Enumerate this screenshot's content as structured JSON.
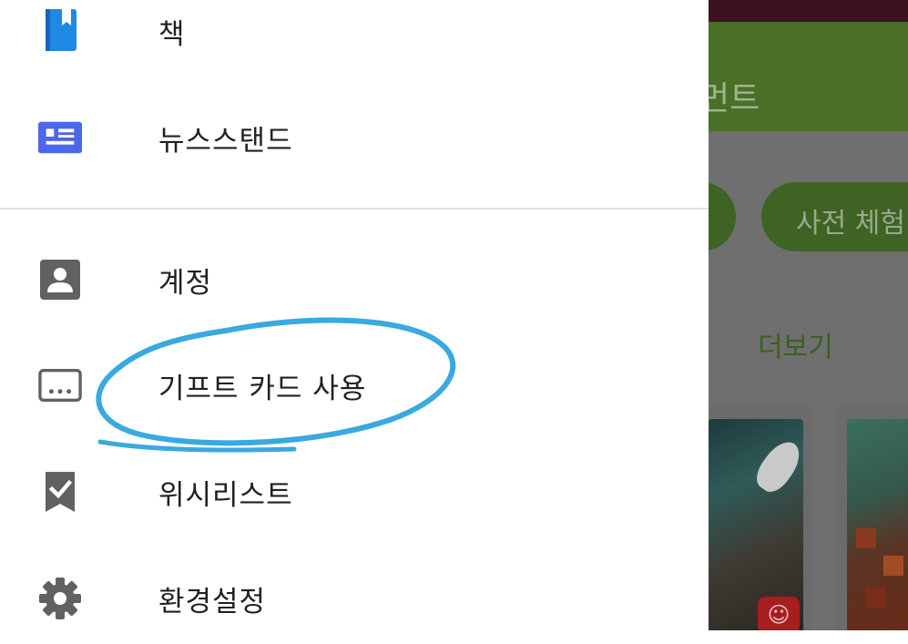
{
  "drawer": {
    "items": [
      {
        "label": "책",
        "icon": "book-icon",
        "color": "#1e88e5"
      },
      {
        "label": "뉴스스탠드",
        "icon": "newsstand-icon",
        "color": "#4a68e8"
      },
      {
        "label": "계정",
        "icon": "account-icon",
        "color": "#616161"
      },
      {
        "label": "기프트 카드 사용",
        "icon": "redeem-card-icon",
        "color": "#616161"
      },
      {
        "label": "위시리스트",
        "icon": "wishlist-icon",
        "color": "#616161"
      },
      {
        "label": "환경설정",
        "icon": "settings-icon",
        "color": "#616161"
      }
    ],
    "highlight_color": "#39a9df"
  },
  "background": {
    "toolbar_title": "먼트",
    "chip_label": "사전 체험",
    "more_link": "더보기",
    "accent_color": "#4a6f27"
  }
}
